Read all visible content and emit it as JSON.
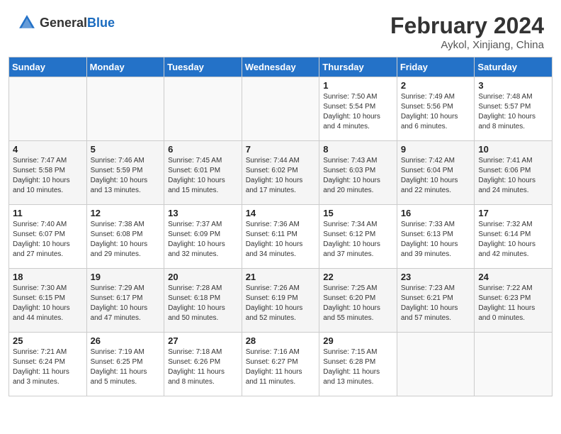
{
  "header": {
    "logo_general": "General",
    "logo_blue": "Blue",
    "month_year": "February 2024",
    "location": "Aykol, Xinjiang, China"
  },
  "days_of_week": [
    "Sunday",
    "Monday",
    "Tuesday",
    "Wednesday",
    "Thursday",
    "Friday",
    "Saturday"
  ],
  "weeks": [
    [
      {
        "day": "",
        "info": ""
      },
      {
        "day": "",
        "info": ""
      },
      {
        "day": "",
        "info": ""
      },
      {
        "day": "",
        "info": ""
      },
      {
        "day": "1",
        "info": "Sunrise: 7:50 AM\nSunset: 5:54 PM\nDaylight: 10 hours\nand 4 minutes."
      },
      {
        "day": "2",
        "info": "Sunrise: 7:49 AM\nSunset: 5:56 PM\nDaylight: 10 hours\nand 6 minutes."
      },
      {
        "day": "3",
        "info": "Sunrise: 7:48 AM\nSunset: 5:57 PM\nDaylight: 10 hours\nand 8 minutes."
      }
    ],
    [
      {
        "day": "4",
        "info": "Sunrise: 7:47 AM\nSunset: 5:58 PM\nDaylight: 10 hours\nand 10 minutes."
      },
      {
        "day": "5",
        "info": "Sunrise: 7:46 AM\nSunset: 5:59 PM\nDaylight: 10 hours\nand 13 minutes."
      },
      {
        "day": "6",
        "info": "Sunrise: 7:45 AM\nSunset: 6:01 PM\nDaylight: 10 hours\nand 15 minutes."
      },
      {
        "day": "7",
        "info": "Sunrise: 7:44 AM\nSunset: 6:02 PM\nDaylight: 10 hours\nand 17 minutes."
      },
      {
        "day": "8",
        "info": "Sunrise: 7:43 AM\nSunset: 6:03 PM\nDaylight: 10 hours\nand 20 minutes."
      },
      {
        "day": "9",
        "info": "Sunrise: 7:42 AM\nSunset: 6:04 PM\nDaylight: 10 hours\nand 22 minutes."
      },
      {
        "day": "10",
        "info": "Sunrise: 7:41 AM\nSunset: 6:06 PM\nDaylight: 10 hours\nand 24 minutes."
      }
    ],
    [
      {
        "day": "11",
        "info": "Sunrise: 7:40 AM\nSunset: 6:07 PM\nDaylight: 10 hours\nand 27 minutes."
      },
      {
        "day": "12",
        "info": "Sunrise: 7:38 AM\nSunset: 6:08 PM\nDaylight: 10 hours\nand 29 minutes."
      },
      {
        "day": "13",
        "info": "Sunrise: 7:37 AM\nSunset: 6:09 PM\nDaylight: 10 hours\nand 32 minutes."
      },
      {
        "day": "14",
        "info": "Sunrise: 7:36 AM\nSunset: 6:11 PM\nDaylight: 10 hours\nand 34 minutes."
      },
      {
        "day": "15",
        "info": "Sunrise: 7:34 AM\nSunset: 6:12 PM\nDaylight: 10 hours\nand 37 minutes."
      },
      {
        "day": "16",
        "info": "Sunrise: 7:33 AM\nSunset: 6:13 PM\nDaylight: 10 hours\nand 39 minutes."
      },
      {
        "day": "17",
        "info": "Sunrise: 7:32 AM\nSunset: 6:14 PM\nDaylight: 10 hours\nand 42 minutes."
      }
    ],
    [
      {
        "day": "18",
        "info": "Sunrise: 7:30 AM\nSunset: 6:15 PM\nDaylight: 10 hours\nand 44 minutes."
      },
      {
        "day": "19",
        "info": "Sunrise: 7:29 AM\nSunset: 6:17 PM\nDaylight: 10 hours\nand 47 minutes."
      },
      {
        "day": "20",
        "info": "Sunrise: 7:28 AM\nSunset: 6:18 PM\nDaylight: 10 hours\nand 50 minutes."
      },
      {
        "day": "21",
        "info": "Sunrise: 7:26 AM\nSunset: 6:19 PM\nDaylight: 10 hours\nand 52 minutes."
      },
      {
        "day": "22",
        "info": "Sunrise: 7:25 AM\nSunset: 6:20 PM\nDaylight: 10 hours\nand 55 minutes."
      },
      {
        "day": "23",
        "info": "Sunrise: 7:23 AM\nSunset: 6:21 PM\nDaylight: 10 hours\nand 57 minutes."
      },
      {
        "day": "24",
        "info": "Sunrise: 7:22 AM\nSunset: 6:23 PM\nDaylight: 11 hours\nand 0 minutes."
      }
    ],
    [
      {
        "day": "25",
        "info": "Sunrise: 7:21 AM\nSunset: 6:24 PM\nDaylight: 11 hours\nand 3 minutes."
      },
      {
        "day": "26",
        "info": "Sunrise: 7:19 AM\nSunset: 6:25 PM\nDaylight: 11 hours\nand 5 minutes."
      },
      {
        "day": "27",
        "info": "Sunrise: 7:18 AM\nSunset: 6:26 PM\nDaylight: 11 hours\nand 8 minutes."
      },
      {
        "day": "28",
        "info": "Sunrise: 7:16 AM\nSunset: 6:27 PM\nDaylight: 11 hours\nand 11 minutes."
      },
      {
        "day": "29",
        "info": "Sunrise: 7:15 AM\nSunset: 6:28 PM\nDaylight: 11 hours\nand 13 minutes."
      },
      {
        "day": "",
        "info": ""
      },
      {
        "day": "",
        "info": ""
      }
    ]
  ]
}
